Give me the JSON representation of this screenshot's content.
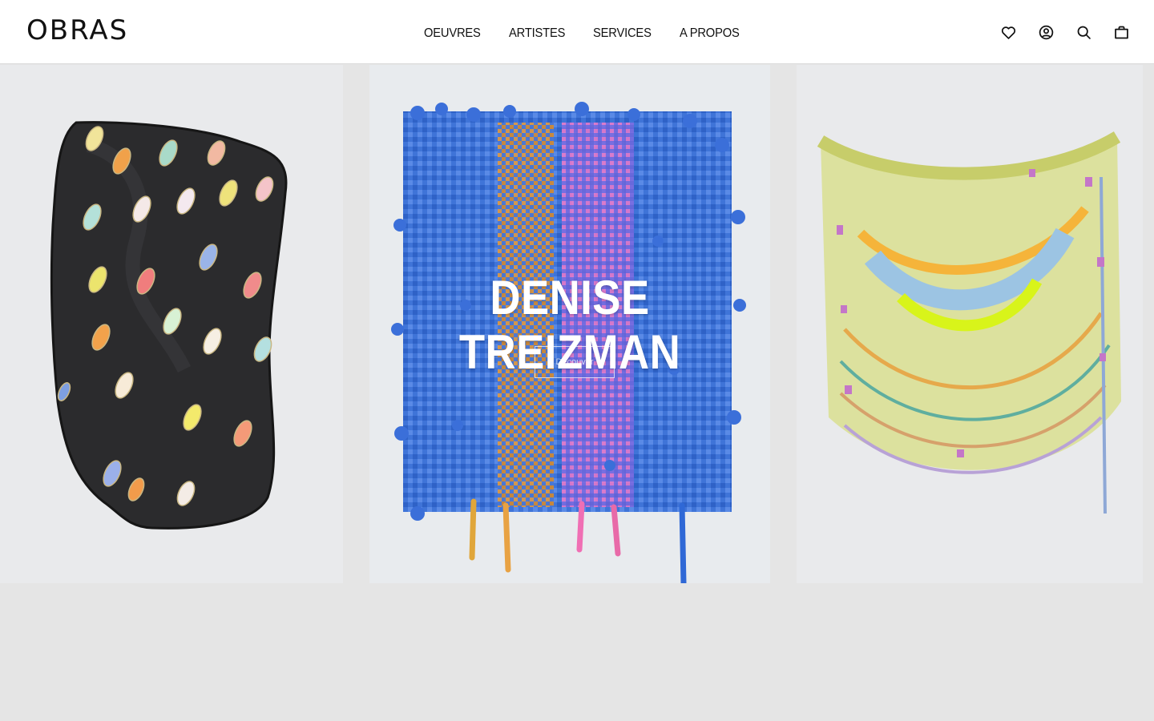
{
  "brand": {
    "logo": "OBRAS"
  },
  "nav": {
    "items": [
      {
        "label": "OEUVRES"
      },
      {
        "label": "ARTISTES"
      },
      {
        "label": "SERVICES"
      },
      {
        "label": "A PROPOS"
      }
    ]
  },
  "header_icons": [
    "heart-icon",
    "account-icon",
    "search-icon",
    "bag-icon"
  ],
  "hero": {
    "title": "DENISE TREIZMAN",
    "button_label": "Découvrir",
    "artworks": [
      "ceramic-dots-artwork",
      "woven-balloons-artwork",
      "textile-hanging-artwork"
    ]
  },
  "colors": {
    "header_bg": "#ffffff",
    "page_bg": "#e5e5e5",
    "text": "#111111",
    "hero_text": "#ffffff"
  }
}
